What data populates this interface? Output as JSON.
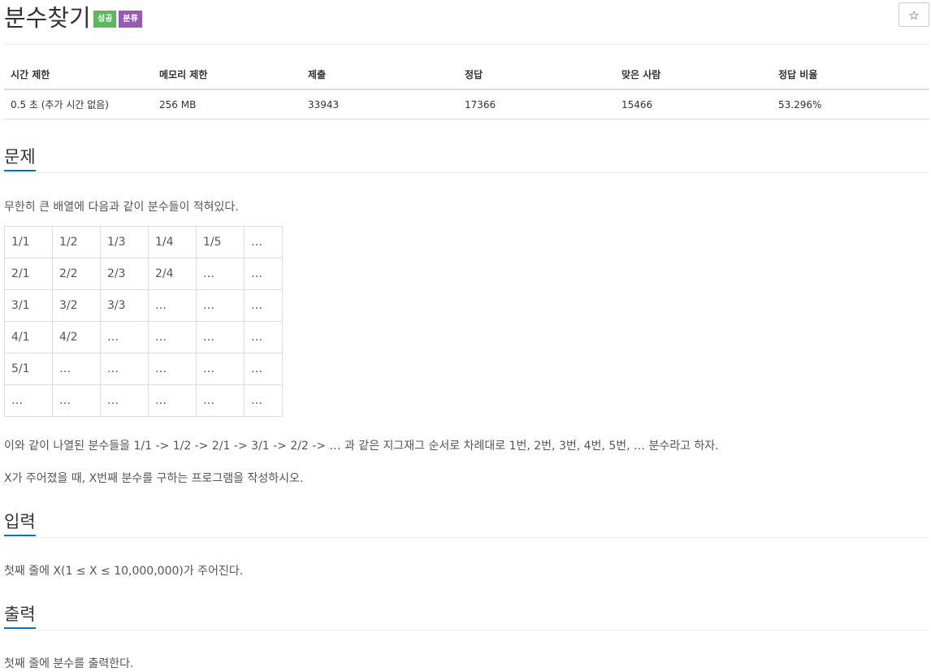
{
  "problem": {
    "title": "분수찾기",
    "badges": [
      "성공",
      "분류"
    ],
    "star": "☆"
  },
  "info": {
    "headers": [
      "시간 제한",
      "메모리 제한",
      "제출",
      "정답",
      "맞은 사람",
      "정답 비율"
    ],
    "values": [
      "0.5 초 (추가 시간 없음)",
      "256 MB",
      "33943",
      "17366",
      "15466",
      "53.296%"
    ]
  },
  "sections": {
    "problem_label": "문제",
    "input_label": "입력",
    "output_label": "출력"
  },
  "text": {
    "intro": "무한히 큰 배열에 다음과 같이 분수들이 적혀있다.",
    "order": "이와 같이 나열된 분수들을 1/1 -> 1/2 -> 2/1 -> 3/1 -> 2/2 -> … 과 같은 지그재그 순서로 차례대로 1번, 2번, 3번, 4번, 5번, … 분수라고 하자.",
    "task": "X가 주어졌을 때, X번째 분수를 구하는 프로그램을 작성하시오.",
    "input": "첫째 줄에 X(1 ≤ X ≤ 10,000,000)가 주어진다.",
    "output": "첫째 줄에 분수를 출력한다."
  },
  "grid": [
    [
      "1/1",
      "1/2",
      "1/3",
      "1/4",
      "1/5",
      "…"
    ],
    [
      "2/1",
      "2/2",
      "2/3",
      "2/4",
      "…",
      "…"
    ],
    [
      "3/1",
      "3/2",
      "3/3",
      "…",
      "…",
      "…"
    ],
    [
      "4/1",
      "4/2",
      "…",
      "…",
      "…",
      "…"
    ],
    [
      "5/1",
      "…",
      "…",
      "…",
      "…",
      "…"
    ],
    [
      "…",
      "…",
      "…",
      "…",
      "…",
      "…"
    ]
  ]
}
